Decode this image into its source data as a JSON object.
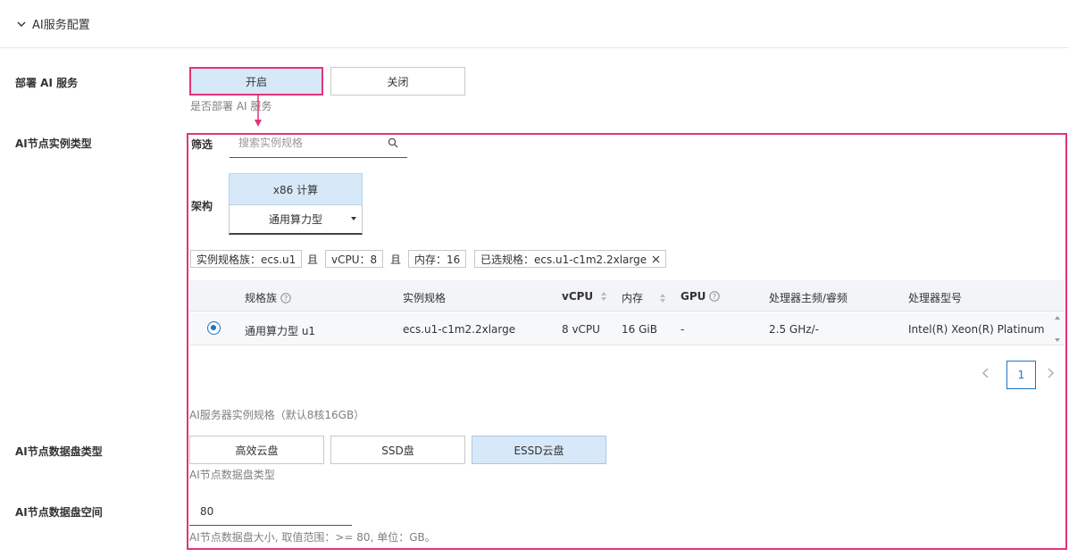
{
  "section": {
    "title": "AI服务配置"
  },
  "deploy": {
    "label": "部署 AI 服务",
    "on_label": "开启",
    "off_label": "关闭",
    "hint": "是否部署 AI 服务"
  },
  "instance": {
    "label": "AI节点实例类型",
    "filter_label": "筛选",
    "search_placeholder": "搜索实例规格",
    "arch_label": "架构",
    "arch_tab": "x86 计算",
    "arch_select": "通用算力型",
    "tags": {
      "family": "实例规格族：ecs.u1",
      "vcpu": "vCPU：8",
      "memory": "内存：16",
      "selected": "已选规格：ecs.u1-c1m2.2xlarge"
    },
    "and_text": "且",
    "table": {
      "headers": {
        "family": "规格族",
        "spec": "实例规格",
        "vcpu": "vCPU",
        "memory": "内存",
        "gpu": "GPU",
        "freq": "处理器主频/睿频",
        "cpu_model": "处理器型号"
      },
      "rows": [
        {
          "selected": true,
          "family": "通用算力型 u1",
          "spec": "ecs.u1-c1m2.2xlarge",
          "vcpu": "8 vCPU",
          "memory": "16 GiB",
          "gpu": "-",
          "freq": "2.5 GHz/-",
          "cpu_model": "Intel(R) Xeon(R) Platinum"
        }
      ]
    },
    "pager": {
      "current": "1"
    },
    "hint": "AI服务器实例规格（默认8核16GB）"
  },
  "disk_type": {
    "label": "AI节点数据盘类型",
    "options": [
      "高效云盘",
      "SSD盘",
      "ESSD云盘"
    ],
    "hint": "AI节点数据盘类型"
  },
  "disk_size": {
    "label": "AI节点数据盘空间",
    "value": "80",
    "hint": "AI节点数据盘大小, 取值范围：>= 80, 单位：GB。"
  },
  "colors": {
    "accent": "#1a73c9",
    "highlight": "#e0347a",
    "active_bg": "#d7e8f8"
  }
}
